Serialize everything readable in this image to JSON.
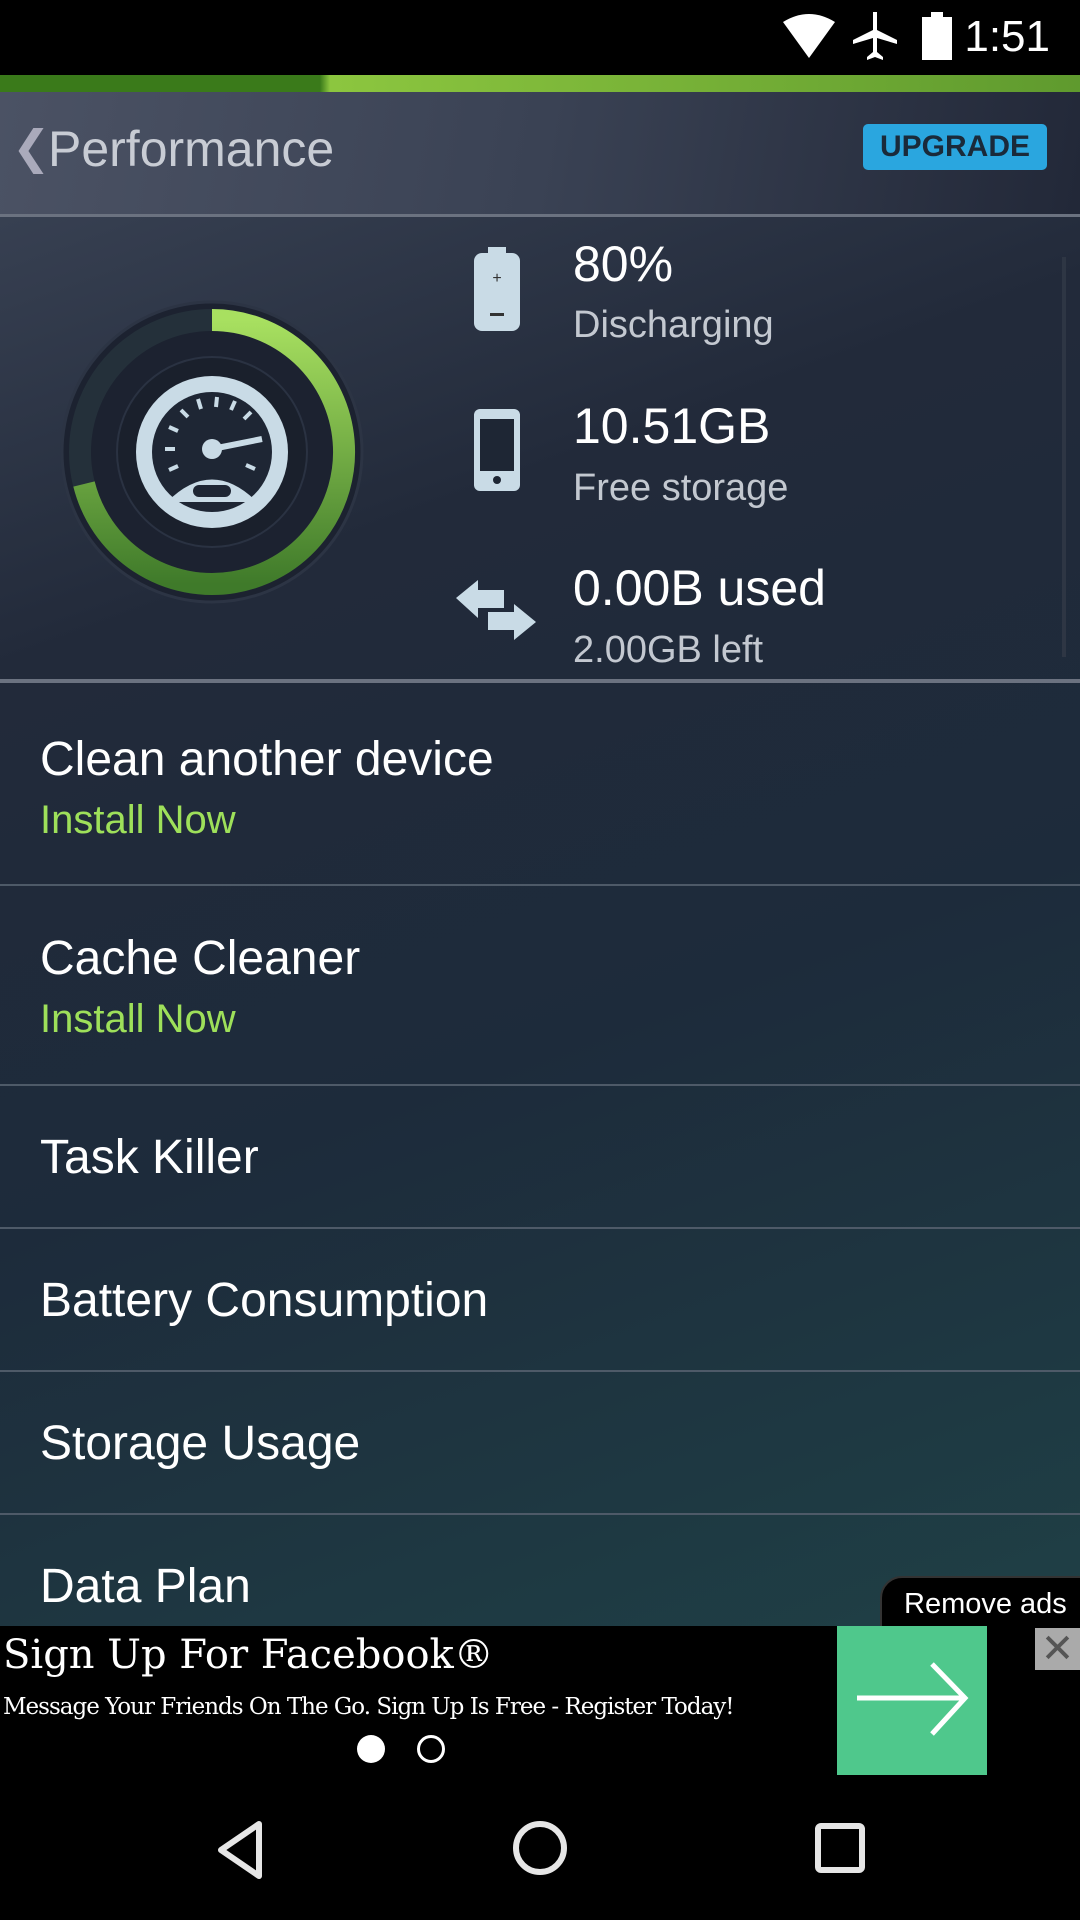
{
  "status_bar": {
    "time": "1:51",
    "icons": [
      "wifi-icon",
      "airplane-icon",
      "battery-icon"
    ]
  },
  "header": {
    "back": "❮",
    "title": "Performance",
    "upgrade": "UPGRADE"
  },
  "stats": {
    "battery": {
      "value": "80%",
      "label": "Discharging"
    },
    "storage": {
      "value": "10.51GB",
      "label": "Free storage"
    },
    "data": {
      "value": "0.00B used",
      "label": "2.00GB left"
    }
  },
  "menu": [
    {
      "title": "Clean another device",
      "action": "Install Now"
    },
    {
      "title": "Cache Cleaner",
      "action": "Install Now"
    },
    {
      "title": "Task Killer"
    },
    {
      "title": "Battery Consumption"
    },
    {
      "title": "Storage Usage"
    },
    {
      "title": "Data Plan"
    }
  ],
  "ad": {
    "remove_ads": "Remove ads",
    "title": "Sign Up For Facebook®",
    "subtitle": "Message Your Friends On The Go. Sign Up Is Free - Register Today!",
    "close": "✕",
    "page_index": 1,
    "page_count": 2
  },
  "colors": {
    "accent": "#8cc63f",
    "upgrade": "#2aa6df",
    "install": "#9ee05a",
    "ad_button": "#4fc88c"
  }
}
